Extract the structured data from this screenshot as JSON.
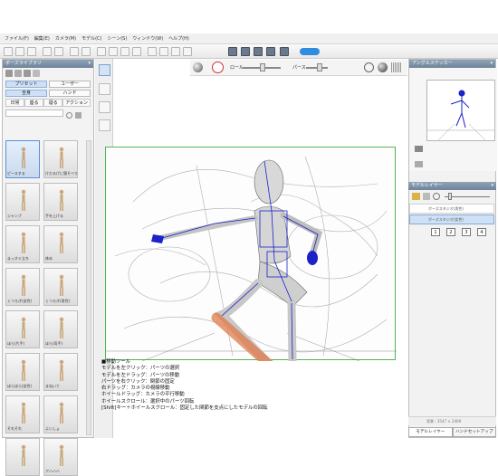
{
  "menubar": [
    "ファイル(F)",
    "編集(E)",
    "カメラ(M)",
    "モデル(C)",
    "シーン(S)",
    "ウィンドウ(W)",
    "ヘルプ(H)"
  ],
  "view_toolbar": {
    "roll_label": "ロール",
    "perspective_label": "パース"
  },
  "pose_library": {
    "title": "ポーズライブラリ",
    "tabs": [
      "プリセット",
      "ユーザー"
    ],
    "subtabs": [
      "全身",
      "ハンド"
    ],
    "categories": [
      "日常",
      "座る",
      "寝る",
      "アクション"
    ],
    "items": [
      {
        "caption": "ピースする"
      },
      {
        "caption": "けだるげに寝そべり"
      },
      {
        "caption": "ジャンプ"
      },
      {
        "caption": "手を上げる"
      },
      {
        "caption": "まっすぐ立ち"
      },
      {
        "caption": "休め"
      },
      {
        "caption": "くつろぎ(女性)"
      },
      {
        "caption": "くつろぎ(男性)"
      },
      {
        "caption": "ほら(片手)"
      },
      {
        "caption": "ほら(両手)"
      },
      {
        "caption": "ほらほら(女性)"
      },
      {
        "caption": "まねいて"
      },
      {
        "caption": "それそれ"
      },
      {
        "caption": "よいしょ"
      },
      {
        "caption": ""
      },
      {
        "caption": "アハハハ"
      }
    ]
  },
  "help_lines": [
    "■移動ツール",
    "モデルを左クリック：パーツの選択",
    "モデルを左ドラッグ：パーツの移動",
    "パーツを右クリック：関節の固定",
    "右ドラッグ：カメラの視線移動",
    "ホイールドラッグ：カメラの平行移動",
    "ホイールスクロール：選択中のパーツ回転",
    "[Shift]キー＋ホイールスクロール：固定した関節を支点にしたモデルの回転"
  ],
  "angle_sticker": {
    "title": "アングルステッカー",
    "buttons": [
      "1",
      "2",
      "3",
      "4"
    ]
  },
  "model_layer": {
    "title": "モデルレイヤー",
    "layers": [
      "ボーズスタジオ(男性)",
      "ボーズスタジオ(女性)"
    ]
  },
  "status": {
    "size_text": "背景 : 3547 × 2409"
  },
  "bottom_tabs": [
    "モデルレイヤー",
    "ハンドセットアップ"
  ],
  "colors": {
    "accent": "#2f8de0",
    "frame": "#54b454",
    "bone": "#1a22c8",
    "highlight": "#e07a4a"
  }
}
